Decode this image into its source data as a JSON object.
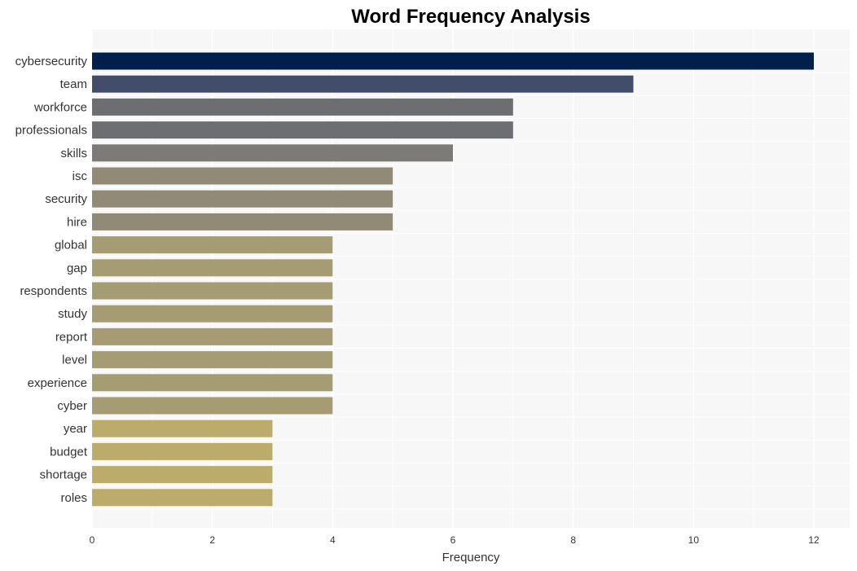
{
  "chart_data": {
    "type": "bar",
    "orientation": "horizontal",
    "title": "Word Frequency Analysis",
    "xlabel": "Frequency",
    "ylabel": "",
    "xlim": [
      0,
      12.6
    ],
    "xticks": [
      0,
      2,
      4,
      6,
      8,
      10,
      12
    ],
    "grid": true,
    "legend": "none",
    "categories": [
      "cybersecurity",
      "team",
      "workforce",
      "professionals",
      "skills",
      "isc",
      "security",
      "hire",
      "global",
      "gap",
      "respondents",
      "study",
      "report",
      "level",
      "experience",
      "cyber",
      "year",
      "budget",
      "shortage",
      "roles"
    ],
    "values": [
      12,
      9,
      7,
      7,
      6,
      5,
      5,
      5,
      4,
      4,
      4,
      4,
      4,
      4,
      4,
      4,
      3,
      3,
      3,
      3
    ],
    "colors": [
      "#00204c",
      "#414d6b",
      "#6c6e72",
      "#6c6e72",
      "#7c7b78",
      "#918a76",
      "#918a76",
      "#918a76",
      "#a59c74",
      "#a59c74",
      "#a59c74",
      "#a59c74",
      "#a59c74",
      "#a59c74",
      "#a59c74",
      "#a59c74",
      "#bbac6b",
      "#bbac6b",
      "#bbac6b",
      "#bbac6b"
    ]
  }
}
